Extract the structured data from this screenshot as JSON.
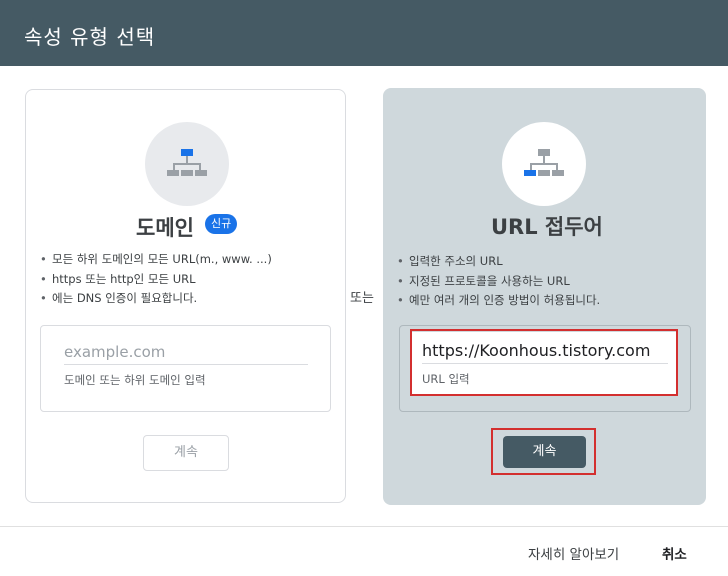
{
  "dialog": {
    "title": "속성 유형 선택"
  },
  "domain_card": {
    "icon": "sitemap-icon",
    "title": "도메인",
    "badge": "신규",
    "bullets": [
      "모든 하위 도메인의 모든 URL(m., www. ...)",
      "https 또는 http인 모든 URL",
      "에는 DNS 인증이 필요합니다."
    ],
    "input_placeholder": "example.com",
    "input_helper": "도메인 또는 하위 도메인 입력",
    "continue_label": "계속"
  },
  "or_label": "또는",
  "url_card": {
    "icon": "sitemap-icon",
    "title": "URL 접두어",
    "bullets": [
      "입력한 주소의 URL",
      "지정된 프로토콜을 사용하는 URL",
      "예만 여러 개의 인증 방법이 허용됩니다."
    ],
    "input_value": "https://Koonhous.tistory.com",
    "input_helper": "URL 입력",
    "continue_label": "계속"
  },
  "footer": {
    "learn_more": "자세히 알아보기",
    "cancel": "취소"
  },
  "colors": {
    "header": "#455a64",
    "selected_card": "#cfd8dc",
    "accent_blue": "#1a73e8",
    "highlight_red": "#d32f2f"
  }
}
